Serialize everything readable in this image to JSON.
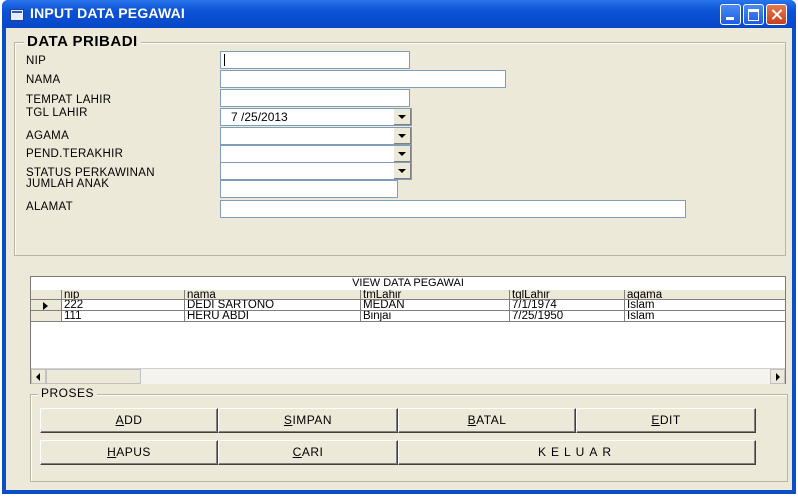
{
  "window": {
    "title": "INPUT DATA PEGAWAI"
  },
  "pribadi": {
    "frame_label": "DATA PRIBADI",
    "labels": {
      "nip": "NIP",
      "nama": "NAMA",
      "tempat_lahir": "TEMPAT LAHIR",
      "tgl_lahir": "TGL LAHIR",
      "agama": "AGAMA",
      "pend": "PEND.TERAKHIR",
      "status": "STATUS PERKAWINAN",
      "jumlah_anak": "JUMLAH ANAK",
      "alamat": "ALAMAT"
    },
    "values": {
      "nip": "",
      "nama": "",
      "tempat_lahir": "",
      "tgl_lahir": "7 /25/2013",
      "agama": "",
      "pend": "",
      "status": "",
      "jumlah_anak": "",
      "alamat": ""
    }
  },
  "grid": {
    "caption": "VIEW DATA PEGAWAI",
    "columns": [
      "nip",
      "nama",
      "tmLahir",
      "tglLahir",
      "agama"
    ],
    "rows": [
      [
        "222",
        "DEDI SARTONO",
        "MEDAN",
        "7/1/1974",
        "Islam"
      ],
      [
        "111",
        "HERU ABDI",
        "Binjai",
        "7/25/1950",
        "Islam"
      ]
    ]
  },
  "proses": {
    "frame_label": "PROSES",
    "buttons": {
      "add": {
        "hot": "A",
        "rest": "DD"
      },
      "simpan": {
        "hot": "S",
        "rest": "IMPAN"
      },
      "batal": {
        "hot": "B",
        "rest": "ATAL"
      },
      "edit": {
        "hot": "E",
        "rest": "DIT"
      },
      "hapus": {
        "hot": "H",
        "rest": "APUS"
      },
      "cari": {
        "hot": "C",
        "rest": "ARI"
      },
      "keluar": "KELUAR"
    }
  },
  "icons": [
    "app-icon",
    "minimize-icon",
    "maximize-icon",
    "close-icon",
    "combo-arrow-icon",
    "row-selector-icon",
    "scroll-left-icon",
    "scroll-right-icon"
  ],
  "colors": {
    "titlebar": "#0b52d6",
    "client": "#ece9d8",
    "close": "#c8401c"
  }
}
